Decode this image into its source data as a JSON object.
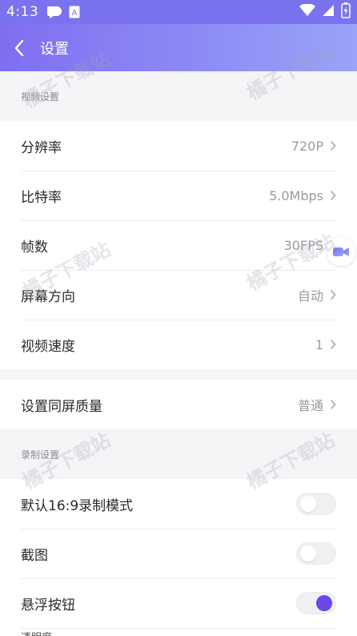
{
  "status_bar": {
    "time": "4:13",
    "app_badge": "A"
  },
  "nav": {
    "title": "设置"
  },
  "video_section": {
    "header": "视频设置",
    "rows": [
      {
        "label": "分辨率",
        "value": "720P"
      },
      {
        "label": "比特率",
        "value": "5.0Mbps"
      },
      {
        "label": "帧数",
        "value": "30FPS"
      },
      {
        "label": "屏幕方向",
        "value": "自动"
      },
      {
        "label": "视频速度",
        "value": "1"
      }
    ]
  },
  "mirror": {
    "label": "设置同屏质量",
    "value": "普通"
  },
  "record_section": {
    "header": "录制设置",
    "rows": [
      {
        "label": "默认16:9录制模式",
        "enabled": false
      },
      {
        "label": "截图",
        "enabled": false
      },
      {
        "label": "悬浮按钮",
        "enabled": true
      }
    ],
    "partial_label": "透明度"
  },
  "watermark": {
    "text": "橘子下载站"
  },
  "colors": {
    "accent": "#6a47e6",
    "header_gradient_start": "#7f6ff0",
    "header_gradient_end": "#99a4f8"
  }
}
